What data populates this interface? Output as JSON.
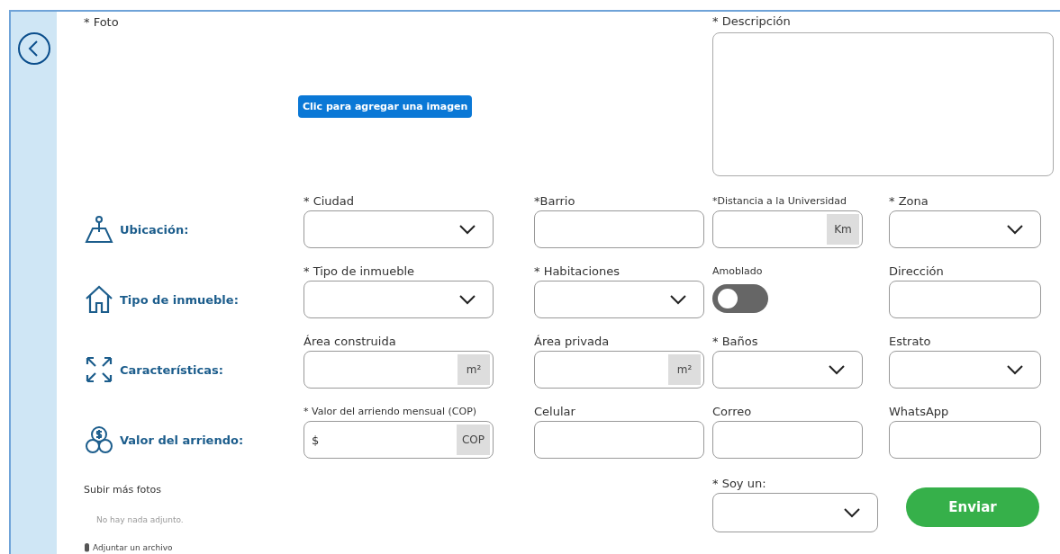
{
  "photo": {
    "label": "* Foto",
    "button": "Clic para agregar una imagen"
  },
  "description": {
    "label": "* Descripción"
  },
  "sections": [
    {
      "label": "Ubicación:",
      "fields": [
        {
          "kind": "select",
          "label": "* Ciudad"
        },
        {
          "kind": "text",
          "label": "*Barrio"
        },
        {
          "kind": "unit",
          "label": "*Distancia a la Universidad",
          "unit": "Km",
          "small": true
        },
        {
          "kind": "select",
          "label": "*  Zona"
        }
      ]
    },
    {
      "label": "Tipo de inmueble:",
      "fields": [
        {
          "kind": "select",
          "label": "* Tipo de inmueble"
        },
        {
          "kind": "select",
          "label": "* Habitaciones"
        },
        {
          "kind": "toggle",
          "label": "Amoblado",
          "on": false,
          "small": true
        },
        {
          "kind": "text",
          "label": "Dirección"
        }
      ]
    },
    {
      "label": "Características:",
      "fields": [
        {
          "kind": "unit",
          "label": "Área construida",
          "unit": "m²"
        },
        {
          "kind": "unit",
          "label": "Área privada",
          "unit": "m²"
        },
        {
          "kind": "select",
          "label": "*  Baños"
        },
        {
          "kind": "select",
          "label": "Estrato"
        }
      ]
    },
    {
      "label": "Valor del arriendo:",
      "fields": [
        {
          "kind": "unit",
          "label": "* Valor del arriendo mensual (COP)",
          "unit": "COP",
          "prefix": "$",
          "small": true
        },
        {
          "kind": "text",
          "label": "Celular"
        },
        {
          "kind": "text",
          "label": "Correo"
        },
        {
          "kind": "text",
          "label": "WhatsApp"
        }
      ]
    }
  ],
  "attachments": {
    "title": "Subir más fotos",
    "empty": "No hay nada adjunto.",
    "attach": "Adjuntar un archivo"
  },
  "role": {
    "label": "* Soy un:",
    "kind": "select"
  },
  "submit": "Enviar"
}
